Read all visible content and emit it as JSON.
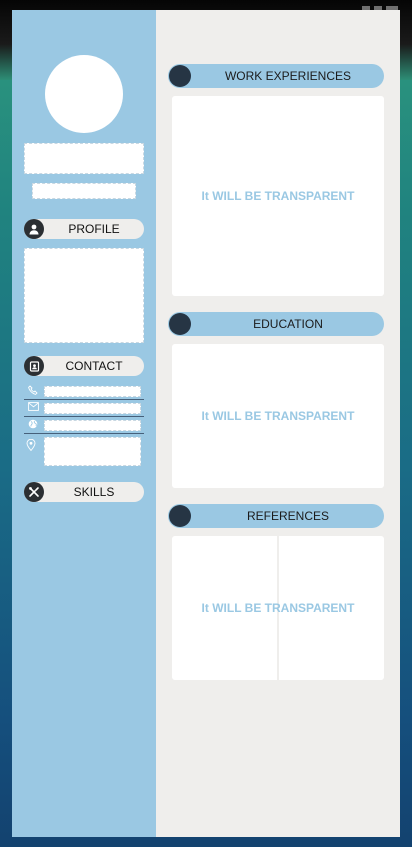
{
  "left_panel": {
    "profile_label": "PROFILE",
    "contact_label": "CONTACT",
    "skills_label": "SKILLS",
    "icons": {
      "profile": "user-icon",
      "contact": "address-book-icon",
      "skills": "tools-icon",
      "phone": "phone-icon",
      "email": "envelope-icon",
      "website": "globe-icon",
      "address": "map-pin-icon"
    }
  },
  "sections": {
    "work": {
      "title": "WORK EXPERIENCES",
      "note": "It WILL BE TRANSPARENT"
    },
    "education": {
      "title": "EDUCATION",
      "note": "It WILL BE TRANSPARENT"
    },
    "references": {
      "title": "REFERENCES",
      "note": "It WILL BE TRANSPARENT"
    }
  },
  "colors": {
    "accent": "#9ac8e3",
    "dark": "#263544",
    "sheet": "#efeeec",
    "note": "#9ac8e3"
  }
}
